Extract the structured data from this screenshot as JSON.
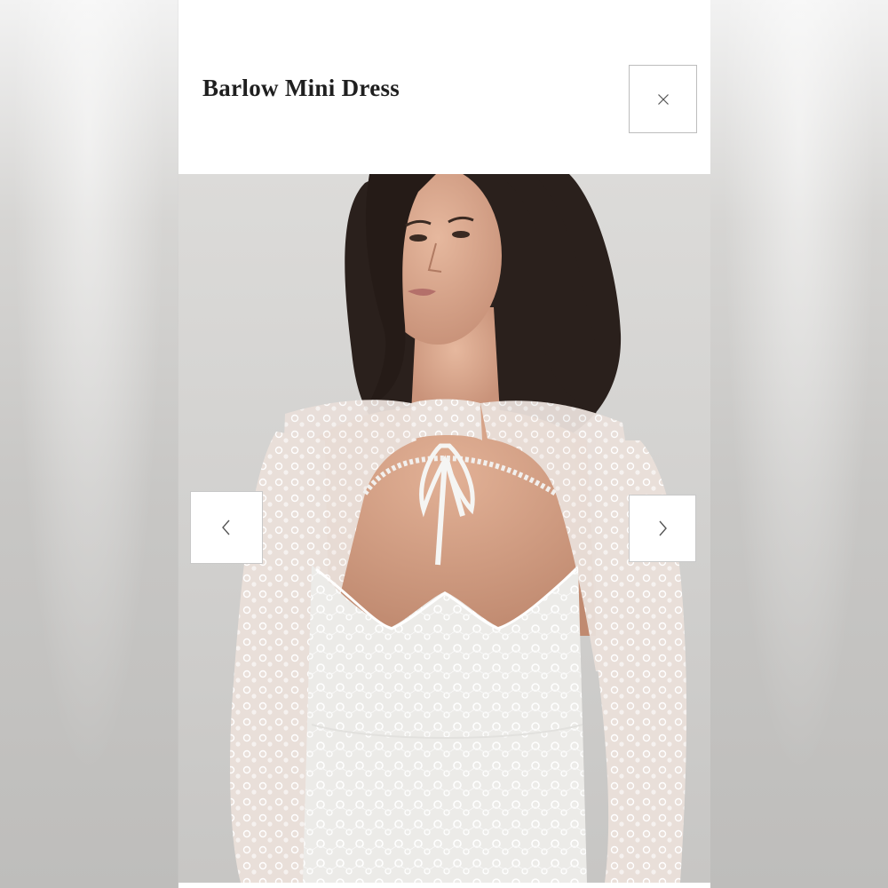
{
  "modal": {
    "title": "Barlow Mini Dress"
  },
  "controls": {
    "close_icon": "close-icon",
    "prev_icon": "chevron-left-icon",
    "next_icon": "chevron-right-icon"
  },
  "gallery": {
    "image_alt": "Model wearing white lace long-sleeve mini dress with keyhole tie neckline"
  },
  "colors": {
    "modal_background": "#ffffff",
    "button_border": "#bdbdbd",
    "title_text": "#1f1f1f",
    "icon_stroke": "#555555"
  }
}
